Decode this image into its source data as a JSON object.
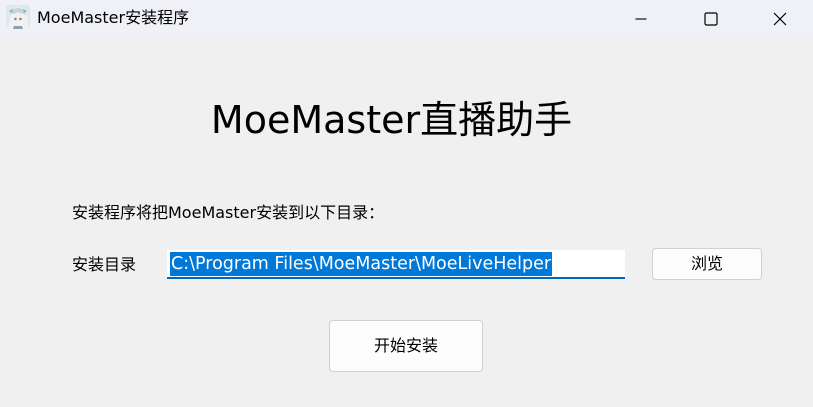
{
  "titlebar": {
    "title": "MoeMaster安装程序",
    "icon": "app-icon",
    "buttons": [
      "minimize-icon",
      "maximize-icon",
      "close-icon"
    ]
  },
  "main": {
    "heading": "MoeMaster直播助手",
    "intro": "安装程序将把MoeMaster安装到以下目录：",
    "dir_label": "安装目录",
    "dir_value": "C:\\Program Files\\MoeMaster\\MoeLiveHelper",
    "browse_label": "浏览",
    "install_label": "开始安装"
  },
  "colors": {
    "background": "#f0f0f0",
    "titlebar": "#eff1f7",
    "selection": "#0078d7",
    "input_underline": "#0067c0"
  }
}
